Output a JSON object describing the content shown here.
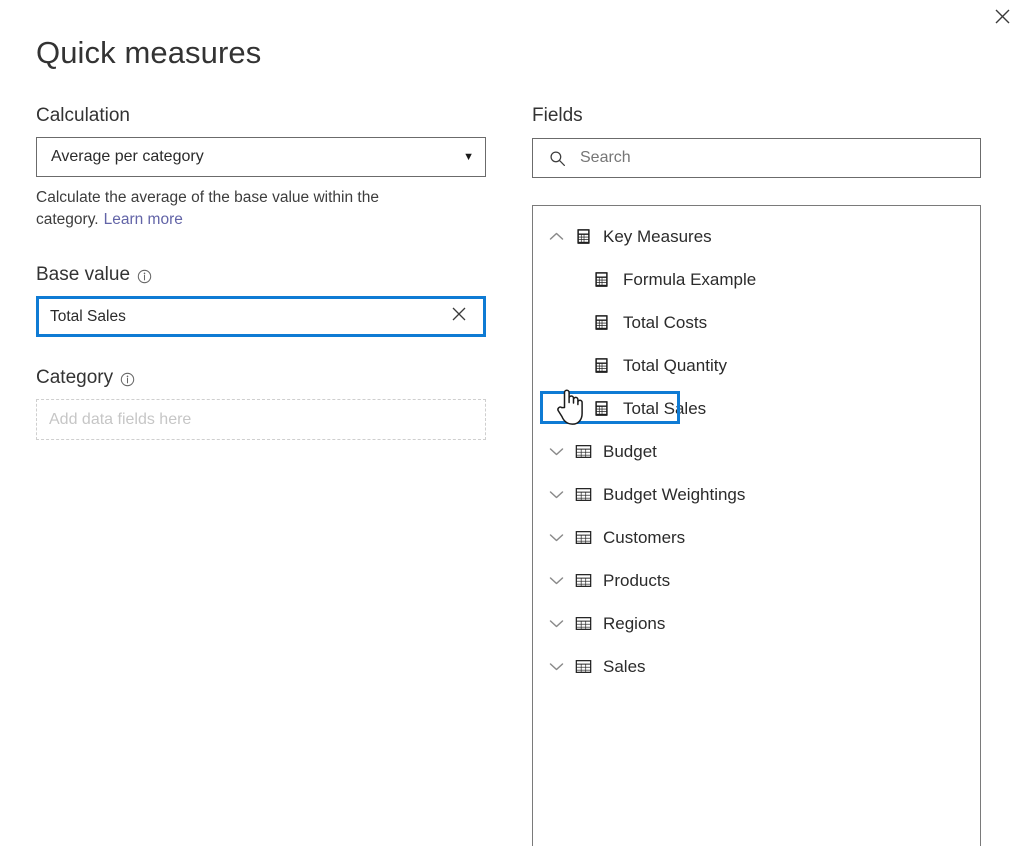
{
  "dialog": {
    "title": "Quick measures",
    "close_label": "Close",
    "close_icon": "close-icon"
  },
  "calculation": {
    "label": "Calculation",
    "selected": "Average per category",
    "caret_icon": "chevron-down-icon",
    "description": "Calculate the average of the base value within the category.",
    "learn_more": "Learn more"
  },
  "base_value": {
    "label": "Base value",
    "info_icon": "info-icon",
    "value": "Total Sales",
    "clear_icon": "close-icon"
  },
  "category": {
    "label": "Category",
    "info_icon": "info-icon",
    "placeholder": "Add data fields here"
  },
  "fields": {
    "heading": "Fields",
    "search": {
      "placeholder": "Search",
      "value": "",
      "icon": "search-icon"
    },
    "tree": [
      {
        "label": "Key Measures",
        "type": "measure-table",
        "icon": "calculator-icon",
        "expander": "chevron-up-icon",
        "expanded": true,
        "selected": false,
        "level": 0
      },
      {
        "label": "Formula Example",
        "type": "measure",
        "icon": "calculator-icon",
        "expander": "",
        "expanded": false,
        "selected": false,
        "level": 1
      },
      {
        "label": "Total Costs",
        "type": "measure",
        "icon": "calculator-icon",
        "expander": "",
        "expanded": false,
        "selected": false,
        "level": 1
      },
      {
        "label": "Total Quantity",
        "type": "measure",
        "icon": "calculator-icon",
        "expander": "",
        "expanded": false,
        "selected": false,
        "level": 1
      },
      {
        "label": "Total Sales",
        "type": "measure",
        "icon": "calculator-icon",
        "expander": "",
        "expanded": false,
        "selected": true,
        "level": 1
      },
      {
        "label": "Budget",
        "type": "table",
        "icon": "table-icon",
        "expander": "chevron-down-icon",
        "expanded": false,
        "selected": false,
        "level": 0
      },
      {
        "label": "Budget Weightings",
        "type": "table",
        "icon": "table-icon",
        "expander": "chevron-down-icon",
        "expanded": false,
        "selected": false,
        "level": 0
      },
      {
        "label": "Customers",
        "type": "table",
        "icon": "table-icon",
        "expander": "chevron-down-icon",
        "expanded": false,
        "selected": false,
        "level": 0
      },
      {
        "label": "Products",
        "type": "table",
        "icon": "table-icon",
        "expander": "chevron-down-icon",
        "expanded": false,
        "selected": false,
        "level": 0
      },
      {
        "label": "Regions",
        "type": "table",
        "icon": "table-icon",
        "expander": "chevron-down-icon",
        "expanded": false,
        "selected": false,
        "level": 0
      },
      {
        "label": "Sales",
        "type": "table",
        "icon": "table-icon",
        "expander": "chevron-down-icon",
        "expanded": false,
        "selected": false,
        "level": 0
      }
    ]
  },
  "cursor": {
    "icon": "hand-pointer-cursor"
  },
  "colors": {
    "accent_blue": "#0f7bd4",
    "link_purple": "#6264a7",
    "border_gray": "#6b6b6b",
    "text": "#333333"
  }
}
